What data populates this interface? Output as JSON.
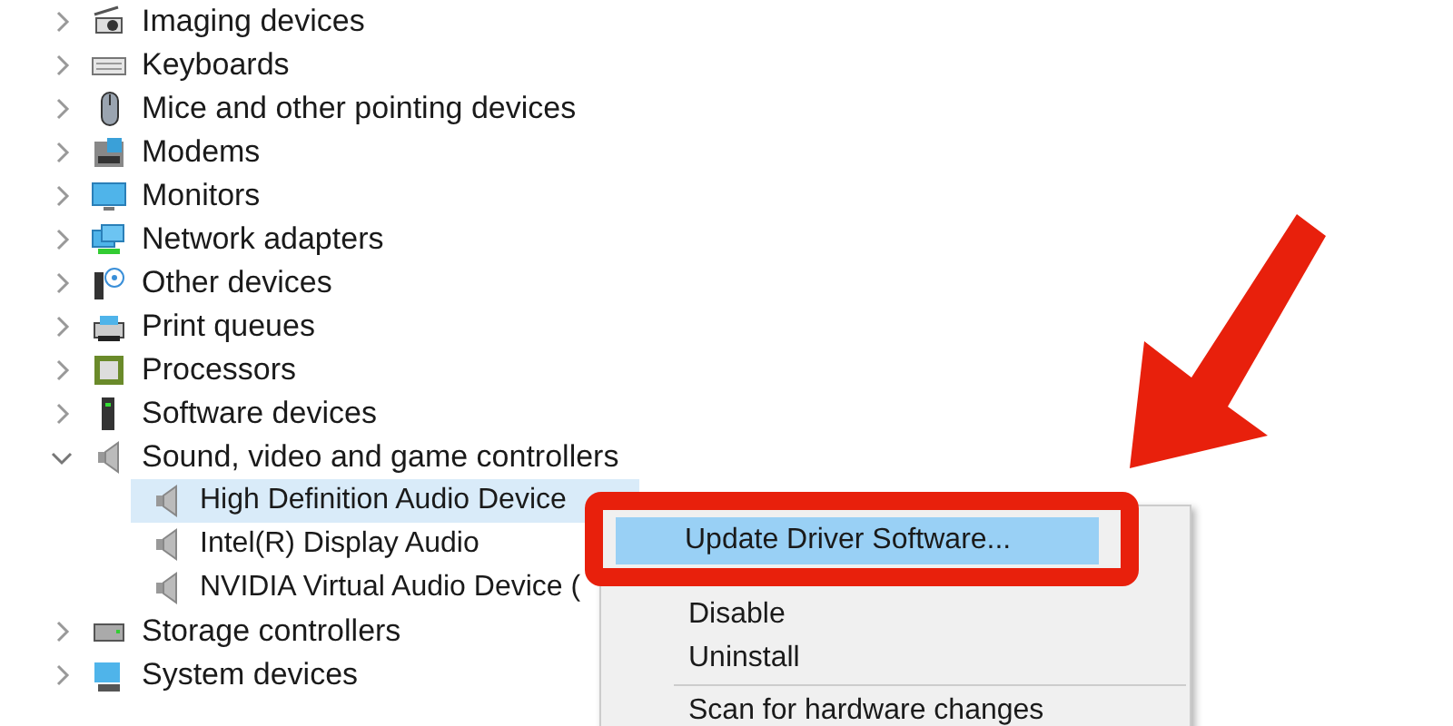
{
  "tree": {
    "items": [
      {
        "label": "Imaging devices",
        "expanded": false
      },
      {
        "label": "Keyboards",
        "expanded": false
      },
      {
        "label": "Mice and other pointing devices",
        "expanded": false
      },
      {
        "label": "Modems",
        "expanded": false
      },
      {
        "label": "Monitors",
        "expanded": false
      },
      {
        "label": "Network adapters",
        "expanded": false
      },
      {
        "label": "Other devices",
        "expanded": false
      },
      {
        "label": "Print queues",
        "expanded": false
      },
      {
        "label": "Processors",
        "expanded": false
      },
      {
        "label": "Software devices",
        "expanded": false
      },
      {
        "label": "Sound, video and game controllers",
        "expanded": true,
        "children": [
          {
            "label": "High Definition Audio Device",
            "selected": true
          },
          {
            "label": "Intel(R) Display Audio",
            "selected": false
          },
          {
            "label": "NVIDIA Virtual Audio Device (",
            "selected": false
          }
        ]
      },
      {
        "label": "Storage controllers",
        "expanded": false
      },
      {
        "label": "System devices",
        "expanded": false
      }
    ]
  },
  "context_menu": {
    "items": [
      {
        "kind": "item",
        "label": "Update Driver Software...",
        "selected": true
      },
      {
        "kind": "item",
        "label": "Disable",
        "selected": false
      },
      {
        "kind": "item",
        "label": "Uninstall",
        "selected": false
      },
      {
        "kind": "separator"
      },
      {
        "kind": "item",
        "label": "Scan for hardware changes",
        "selected": false
      }
    ]
  }
}
